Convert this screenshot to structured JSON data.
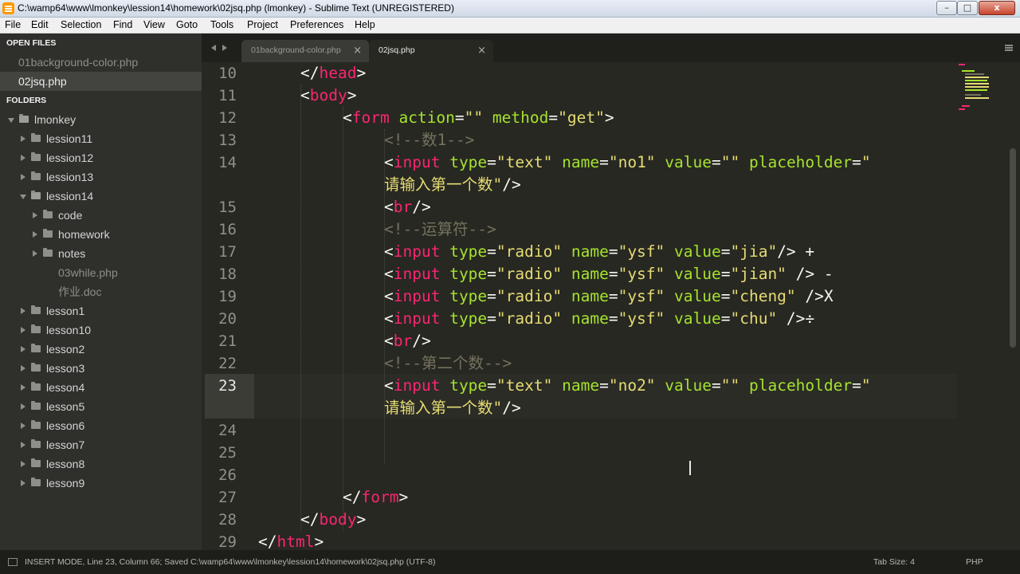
{
  "window": {
    "title": "C:\\wamp64\\www\\lmonkey\\lession14\\homework\\02jsq.php (lmonkey) - Sublime Text (UNREGISTERED)",
    "minimize": "–",
    "maximize": "□",
    "close": "x"
  },
  "menu": [
    "File",
    "Edit",
    "Selection",
    "Find",
    "View",
    "Goto",
    "Tools",
    "Project",
    "Preferences",
    "Help"
  ],
  "sidebar": {
    "open_files_heading": "OPEN FILES",
    "folders_heading": "FOLDERS",
    "open_files": [
      "01background-color.php",
      "02jsq.php"
    ],
    "tree": {
      "root": "lmonkey",
      "lession11": "lession11",
      "lession12": "lession12",
      "lession13": "lession13",
      "lession14": "lession14",
      "code": "code",
      "homework": "homework",
      "notes": "notes",
      "file_03while": "03while.php",
      "file_doc": "作业.doc",
      "lesson1": "lesson1",
      "lesson10": "lesson10",
      "lesson2": "lesson2",
      "lesson3": "lesson3",
      "lesson4": "lesson4",
      "lesson5": "lesson5",
      "lesson6": "lesson6",
      "lesson7": "lesson7",
      "lesson8": "lesson8",
      "lesson9": "lesson9"
    }
  },
  "tabs": [
    {
      "label": "01background-color.php",
      "close": "×"
    },
    {
      "label": "02jsq.php",
      "close": "×"
    }
  ],
  "editor": {
    "line_numbers": [
      "10",
      "11",
      "12",
      "13",
      "14",
      "15",
      "16",
      "17",
      "18",
      "19",
      "20",
      "21",
      "22",
      "23",
      "24",
      "25",
      "26",
      "27",
      "28",
      "29"
    ],
    "active_line": "23",
    "strings": {
      "empty": "\"\"",
      "get": "\"get\"",
      "text": "\"text\"",
      "no1": "\"no1\"",
      "no2": "\"no2\"",
      "radio": "\"radio\"",
      "ysf": "\"ysf\"",
      "jia": "\"jia\"",
      "jian": "\"jian\"",
      "cheng": "\"cheng\"",
      "chu": "\"chu\"",
      "placeholder_open": "\"",
      "placeholder_close": "请输入第一个数\""
    },
    "comments": {
      "c13": "<!--数1-->",
      "c16": "<!--运算符-->",
      "c22": "<!--第二个数-->"
    },
    "symbols": {
      "plus": " +",
      "minus": " -",
      "times": "X",
      "divide": "÷"
    }
  },
  "status": {
    "left": "INSERT MODE, Line 23, Column 66; Saved C:\\wamp64\\www\\lmonkey\\lession14\\homework\\02jsq.php (UTF-8)",
    "tab_size": "Tab Size: 4",
    "syntax": "PHP"
  }
}
